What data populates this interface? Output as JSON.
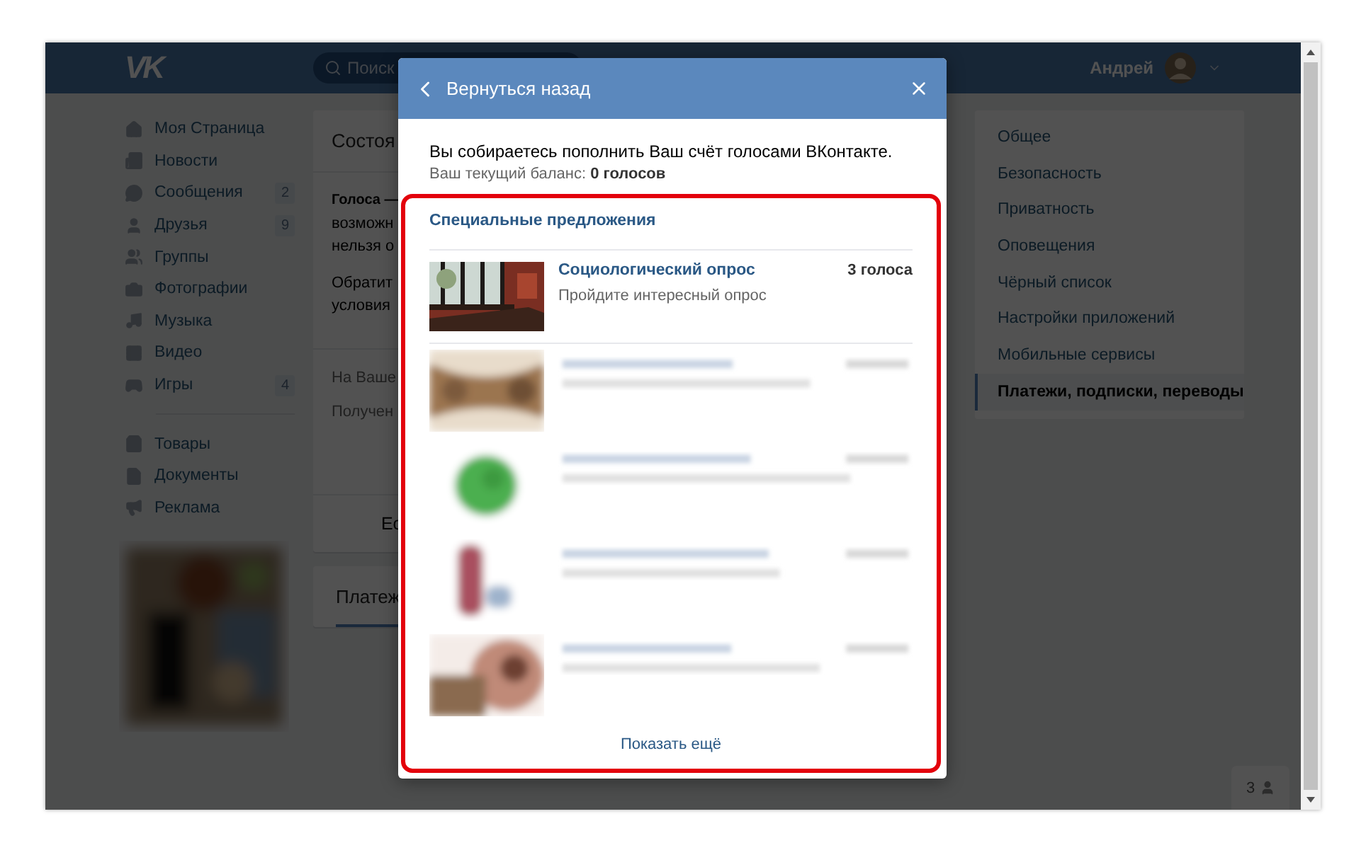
{
  "header": {
    "logo": "VK",
    "search": {
      "placeholder": "Поиск"
    },
    "user": {
      "name": "Андрей"
    }
  },
  "left_menu": {
    "groups": [
      [
        {
          "label": "Моя Страница"
        },
        {
          "label": "Новости"
        },
        {
          "label": "Сообщения",
          "badge": "2"
        },
        {
          "label": "Друзья",
          "badge": "9"
        },
        {
          "label": "Группы"
        },
        {
          "label": "Фотографии"
        },
        {
          "label": "Музыка"
        },
        {
          "label": "Видео"
        },
        {
          "label": "Игры",
          "badge": "4"
        }
      ],
      [
        {
          "label": "Товары"
        },
        {
          "label": "Документы"
        },
        {
          "label": "Реклама"
        }
      ]
    ]
  },
  "middle_column": {
    "card_title": "Состоя",
    "paragraphs": [
      [
        {
          "text": "Голоса —",
          "bold": true
        },
        {
          "text": "возможн",
          "bold": false
        },
        {
          "text": "нельзя о",
          "bold": false
        }
      ],
      [
        {
          "text": "Обратит",
          "bold": false
        },
        {
          "text": "условия",
          "bold": false
        }
      ]
    ],
    "balance_lines": [
      "На Ваше",
      "Получен"
    ],
    "footer": "Ес",
    "tabs": [
      {
        "label": "Платеж",
        "selected": true
      }
    ]
  },
  "settings_menu": [
    {
      "label": "Общее",
      "selected": false
    },
    {
      "label": "Безопасность",
      "selected": false
    },
    {
      "label": "Приватность",
      "selected": false
    },
    {
      "label": "Оповещения",
      "selected": false
    },
    {
      "label": "Чёрный список",
      "selected": false
    },
    {
      "label": "Настройки приложений",
      "selected": false
    },
    {
      "label": "Мобильные сервисы",
      "selected": false
    },
    {
      "label": "Платежи, подписки, переводы",
      "selected": true
    }
  ],
  "modal": {
    "back": "Вернуться назад",
    "intro": "Вы собираетесь пополнить Ваш счёт голосами ВКонтакте.",
    "balance": "Ваш текущий баланс: **0 голосов**",
    "offers_title": "Специальные предложения",
    "offers": [
      {
        "kind": "visible",
        "title": "Социологический опрос",
        "description": "Пройдите интересный опрос",
        "price": "3 голоса"
      },
      {
        "kind": "blurred"
      },
      {
        "kind": "blurred"
      },
      {
        "kind": "blurred"
      },
      {
        "kind": "blurred"
      }
    ],
    "show_more": "Показать ещё"
  },
  "online_badge": {
    "count": "3"
  }
}
